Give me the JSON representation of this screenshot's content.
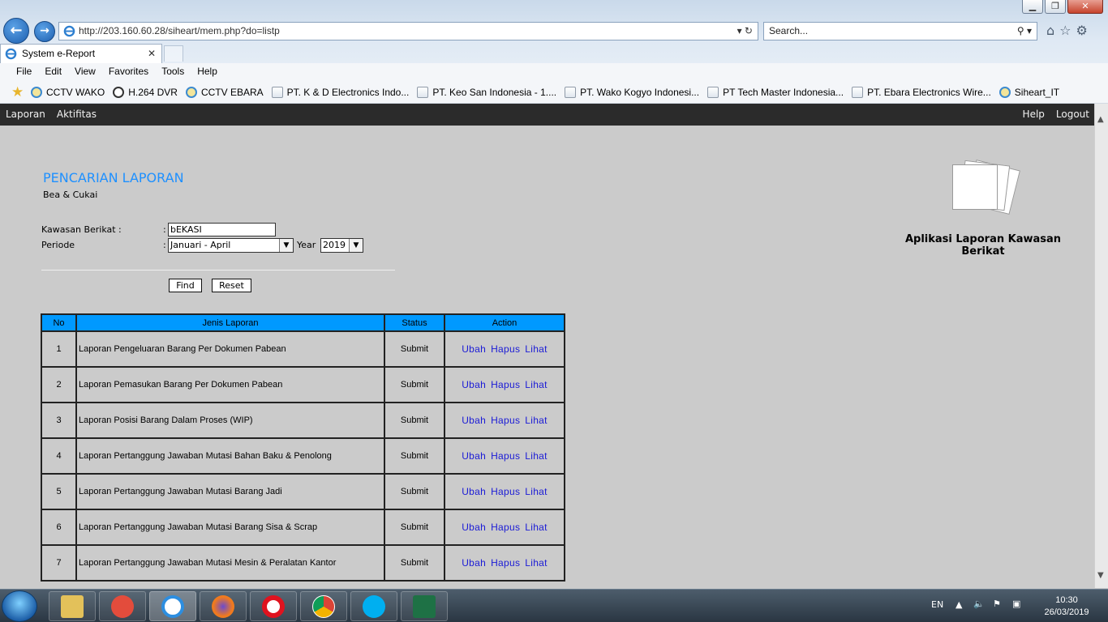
{
  "browser": {
    "url": "http://203.160.60.28/siheart/mem.php?do=listp",
    "search_placeholder": "Search...",
    "tab_title": "System e-Report",
    "menu": [
      "File",
      "Edit",
      "View",
      "Favorites",
      "Tools",
      "Help"
    ],
    "favorites": [
      {
        "label": "CCTV WAKO",
        "icon": "ie-icon"
      },
      {
        "label": "H.264 DVR",
        "icon": "camera-icon"
      },
      {
        "label": "CCTV EBARA",
        "icon": "ie-icon"
      },
      {
        "label": "PT. K & D Electronics Indo...",
        "icon": "page-icon"
      },
      {
        "label": "PT. Keo San Indonesia - 1....",
        "icon": "page-icon"
      },
      {
        "label": "PT. Wako Kogyo Indonesi...",
        "icon": "page-icon"
      },
      {
        "label": "PT Tech Master Indonesia...",
        "icon": "page-icon"
      },
      {
        "label": "PT. Ebara Electronics Wire...",
        "icon": "page-icon"
      },
      {
        "label": "Siheart_IT",
        "icon": "ie-icon"
      }
    ]
  },
  "site_nav": {
    "left": [
      "Laporan",
      "Aktifitas"
    ],
    "right": [
      "Help",
      "Logout"
    ]
  },
  "page": {
    "title": "PENCARIAN LAPORAN",
    "subtitle": "Bea & Cukai",
    "app_name": "Aplikasi Laporan Kawasan Berikat"
  },
  "form": {
    "kawasan_label": "Kawasan Berikat :",
    "kawasan_value": "bEKASI",
    "periode_label": "Periode",
    "colon": ":",
    "periode_value": "Januari - April",
    "year_label": "Year",
    "year_value": "2019",
    "find_label": "Find",
    "reset_label": "Reset"
  },
  "table": {
    "headers": [
      "No",
      "Jenis Laporan",
      "Status",
      "Action"
    ],
    "actions": [
      "Ubah",
      "Hapus",
      "Lihat"
    ],
    "rows": [
      {
        "no": "1",
        "jenis": "Laporan Pengeluaran Barang Per Dokumen Pabean",
        "status": "Submit"
      },
      {
        "no": "2",
        "jenis": "Laporan Pemasukan Barang Per Dokumen Pabean",
        "status": "Submit"
      },
      {
        "no": "3",
        "jenis": "Laporan Posisi Barang Dalam Proses (WIP)",
        "status": "Submit"
      },
      {
        "no": "4",
        "jenis": "Laporan Pertanggung Jawaban Mutasi Bahan Baku & Penolong",
        "status": "Submit"
      },
      {
        "no": "5",
        "jenis": "Laporan Pertanggung Jawaban Mutasi Barang Jadi",
        "status": "Submit"
      },
      {
        "no": "6",
        "jenis": "Laporan Pertanggung Jawaban Mutasi Barang Sisa & Scrap",
        "status": "Submit"
      },
      {
        "no": "7",
        "jenis": "Laporan Pertanggung Jawaban Mutasi Mesin & Peralatan Kantor",
        "status": "Submit"
      }
    ]
  },
  "taskbar": {
    "lang": "EN",
    "time": "10:30",
    "date": "26/03/2019",
    "apps": [
      "file-explorer-icon",
      "chat-app-icon",
      "internet-explorer-icon",
      "firefox-icon",
      "opera-icon",
      "chrome-icon",
      "skype-icon",
      "excel-icon"
    ]
  },
  "colors": {
    "accent": "#1e90ff",
    "table_header": "#0099ff",
    "link": "#1a1ad6",
    "nav_bg": "#2b2b2b",
    "page_bg": "#cbcbcb"
  }
}
